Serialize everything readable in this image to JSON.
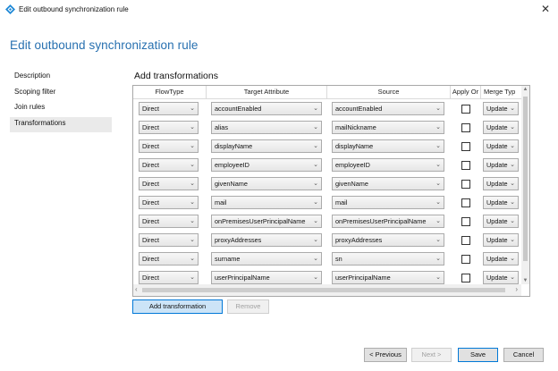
{
  "window": {
    "title": "Edit outbound synchronization rule",
    "close_glyph": "✕",
    "accent": "#2770b0"
  },
  "page_title": "Edit outbound synchronization rule",
  "nav": {
    "items": [
      {
        "label": "Description",
        "active": false
      },
      {
        "label": "Scoping filter",
        "active": false
      },
      {
        "label": "Join rules",
        "active": false
      },
      {
        "label": "Transformations",
        "active": true
      }
    ]
  },
  "section_title": "Add transformations",
  "grid": {
    "columns": {
      "flow_type": "FlowType",
      "target": "Target Attribute",
      "source": "Source",
      "apply_once": "Apply Or",
      "merge_type": "Merge Typ"
    },
    "rows": [
      {
        "flow": "Direct",
        "target": "accountEnabled",
        "source": "accountEnabled",
        "apply": false,
        "merge": "Update"
      },
      {
        "flow": "Direct",
        "target": "alias",
        "source": "mailNickname",
        "apply": false,
        "merge": "Update"
      },
      {
        "flow": "Direct",
        "target": "displayName",
        "source": "displayName",
        "apply": false,
        "merge": "Update"
      },
      {
        "flow": "Direct",
        "target": "employeeID",
        "source": "employeeID",
        "apply": false,
        "merge": "Update"
      },
      {
        "flow": "Direct",
        "target": "givenName",
        "source": "givenName",
        "apply": false,
        "merge": "Update"
      },
      {
        "flow": "Direct",
        "target": "mail",
        "source": "mail",
        "apply": false,
        "merge": "Update"
      },
      {
        "flow": "Direct",
        "target": "onPremisesUserPrincipalName",
        "source": "onPremisesUserPrincipalName",
        "apply": false,
        "merge": "Update"
      },
      {
        "flow": "Direct",
        "target": "proxyAddresses",
        "source": "proxyAddresses",
        "apply": false,
        "merge": "Update"
      },
      {
        "flow": "Direct",
        "target": "surname",
        "source": "sn",
        "apply": false,
        "merge": "Update"
      },
      {
        "flow": "Direct",
        "target": "userPrincipalName",
        "source": "userPrincipalName",
        "apply": false,
        "merge": "Update"
      }
    ]
  },
  "buttons": {
    "add_transformation": "Add transformation",
    "remove": "Remove",
    "previous": "< Previous",
    "next": "Next >",
    "save": "Save",
    "cancel": "Cancel"
  }
}
